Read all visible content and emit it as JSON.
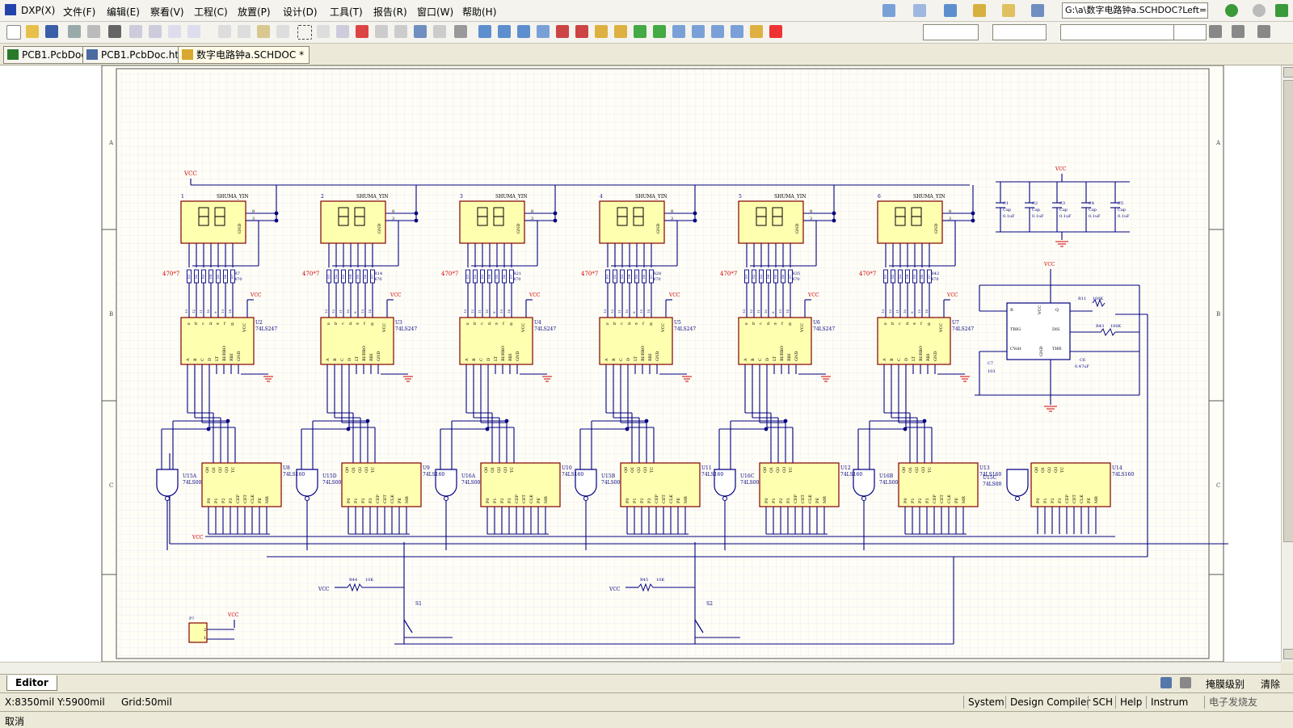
{
  "app": {
    "logo_label": "DXP",
    "brand_color": "#2244aa"
  },
  "menu": [
    {
      "id": "dxp",
      "label": "DXP(X)"
    },
    {
      "id": "file",
      "label": "文件(F)"
    },
    {
      "id": "edit",
      "label": "编辑(E)"
    },
    {
      "id": "view",
      "label": "察看(V)"
    },
    {
      "id": "project",
      "label": "工程(C)"
    },
    {
      "id": "place",
      "label": "放置(P)"
    },
    {
      "id": "design",
      "label": "设计(D)"
    },
    {
      "id": "tools",
      "label": "工具(T)"
    },
    {
      "id": "reports",
      "label": "报告(R)"
    },
    {
      "id": "window",
      "label": "窗口(W)"
    },
    {
      "id": "help",
      "label": "帮助(H)"
    }
  ],
  "path_box": "G:\\a\\数字电路钟a.SCHDOC?Left=-1:",
  "doc_tabs": [
    {
      "label": "PCB1.PcbDoc",
      "active": false
    },
    {
      "label": "PCB1.PcbDoc.htm",
      "active": false
    },
    {
      "label": "数字电路钟a.SCHDOC *",
      "active": true
    }
  ],
  "schematic": {
    "border_rows": [
      "A",
      "B",
      "C"
    ],
    "displays": [
      {
        "num": "1",
        "name": "SHUMA_YIN",
        "resistor": "R7",
        "res_val": "470",
        "pack": "470*7",
        "driver": "U2",
        "driver_type": "74LS247",
        "counter": "U8",
        "counter_type": "74LS160",
        "gate": "U15A",
        "gate_type": "74LS00"
      },
      {
        "num": "2",
        "name": "SHUMA_YIN",
        "resistor": "R14",
        "res_val": "470",
        "pack": "470*7",
        "driver": "U3",
        "driver_type": "74LS247",
        "counter": "U9",
        "counter_type": "74LS160",
        "gate": "U15D",
        "gate_type": "74LS00"
      },
      {
        "num": "3",
        "name": "SHUMA_YIN",
        "resistor": "R21",
        "res_val": "470",
        "pack": "470*7",
        "driver": "U4",
        "driver_type": "74LS247",
        "counter": "U10",
        "counter_type": "74LS160",
        "gate": "U16A",
        "gate_type": "74LS00"
      },
      {
        "num": "4",
        "name": "SHUMA_YIN",
        "resistor": "R28",
        "res_val": "470",
        "pack": "470*7",
        "driver": "U5",
        "driver_type": "74LS247",
        "counter": "U11",
        "counter_type": "74LS160",
        "gate": "U15B",
        "gate_type": "74LS00"
      },
      {
        "num": "5",
        "name": "SHUMA_YIN",
        "resistor": "R35",
        "res_val": "470",
        "pack": "470*7",
        "driver": "U6",
        "driver_type": "74LS247",
        "counter": "U12",
        "counter_type": "74LS160",
        "gate": "U16C",
        "gate_type": "74LS00"
      },
      {
        "num": "6",
        "name": "SHUMA_YIN",
        "resistor": "R42",
        "res_val": "470",
        "pack": "470*7",
        "driver": "U7",
        "driver_type": "74LS247",
        "counter": "U13",
        "counter_type": "74LS160",
        "gate": "U16B",
        "gate_type": "74LS00"
      }
    ],
    "extra_counter": {
      "ref": "U14",
      "type": "74LS160",
      "gate": "U15C",
      "gate_type": "74LS00"
    },
    "vcc_label": "VCC",
    "drv_top_pins": [
      "a",
      "b",
      "c",
      "d",
      "e",
      "f",
      "g"
    ],
    "drv_bot_pins": [
      "A",
      "B",
      "C",
      "D",
      "LT",
      "BI/RBO",
      "RBI",
      "GND"
    ],
    "drv_vcc_pin": "VCC",
    "drv_pin_nums": [
      "13",
      "12",
      "11",
      "10",
      "9",
      "15",
      "14"
    ],
    "cnt_top_pins": [
      "Q0",
      "Q1",
      "Q2",
      "Q3",
      "TC"
    ],
    "cnt_bot_pins": [
      "P0",
      "P1",
      "P2",
      "P3",
      "CEP",
      "CET",
      "CLK",
      "PE",
      "MR"
    ],
    "seg_gnd": "GND",
    "caps": [
      {
        "ref": "C1",
        "type": "Cap",
        "val": "0.1uF"
      },
      {
        "ref": "C2",
        "type": "Cap",
        "val": "0.1uF"
      },
      {
        "ref": "C3",
        "type": "Cap",
        "val": "0.1uF"
      },
      {
        "ref": "C4",
        "type": "Cap",
        "val": "0.1uF"
      },
      {
        "ref": "C5",
        "type": "Cap",
        "val": "0.1uF"
      }
    ],
    "timer": {
      "pins": [
        "R",
        "VCC",
        "Q",
        "TRIG",
        "DIS",
        "CVolt",
        "THR",
        "GND"
      ],
      "pin_nums": [
        "4",
        "8",
        "3",
        "2",
        "7",
        "5",
        "6",
        "1"
      ],
      "r11": "R11",
      "r11_val": "100K",
      "r43": "R43",
      "r43_val": "100K",
      "c6": "C6",
      "c6_val": "0.47uF",
      "c7": "C7",
      "c7_val": "103"
    },
    "r44": "R44",
    "r44_val": "10K",
    "r45": "R45",
    "r45_val": "10K",
    "s1": "S1",
    "s2": "S2",
    "p_ref": "P?",
    "p_pins": [
      "2",
      "1"
    ]
  },
  "editor_tab": "Editor",
  "right_tools": [
    "掩膜级别",
    "清除"
  ],
  "status": {
    "coords": "X:8350mil Y:5900mil",
    "grid": "Grid:50mil"
  },
  "panels": [
    "System",
    "Design Compiler",
    "SCH",
    "Help",
    "Instrum",
    "电子发烧友"
  ],
  "command": "取消",
  "colors": {
    "wire": "#000080",
    "part_fill": "#ffffb0",
    "part_border": "#800000",
    "grid": "#eeeaf6",
    "red_text": "#cc0000"
  }
}
